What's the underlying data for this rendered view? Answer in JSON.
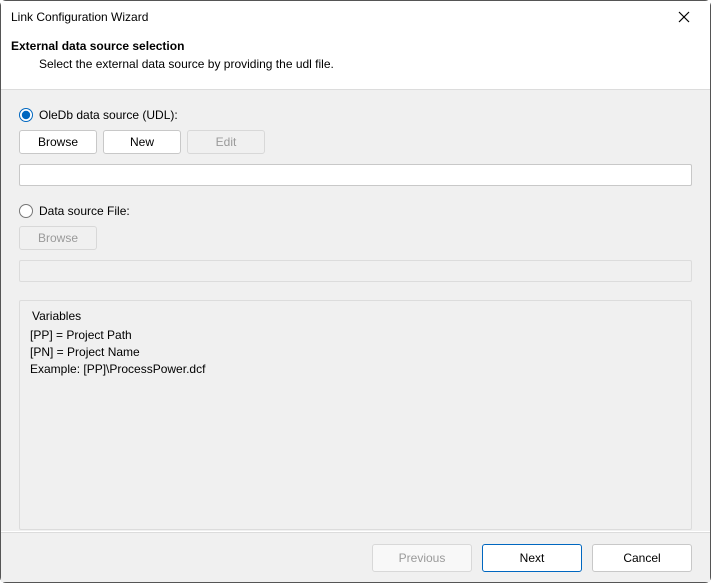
{
  "titlebar": {
    "title": "Link Configuration Wizard"
  },
  "header": {
    "heading": "External data source selection",
    "subheading": "Select the external data source by providing the udl file."
  },
  "oledb": {
    "radio_label": "OleDb data source (UDL):",
    "browse_label": "Browse",
    "new_label": "New",
    "edit_label": "Edit",
    "path_value": ""
  },
  "file": {
    "radio_label": "Data source File:",
    "browse_label": "Browse",
    "path_value": ""
  },
  "variables": {
    "legend": "Variables",
    "line1": "[PP] =   Project Path",
    "line2": "[PN] =   Project Name",
    "line3": "Example: [PP]\\ProcessPower.dcf"
  },
  "footer": {
    "previous_label": "Previous",
    "next_label": "Next",
    "cancel_label": "Cancel"
  }
}
